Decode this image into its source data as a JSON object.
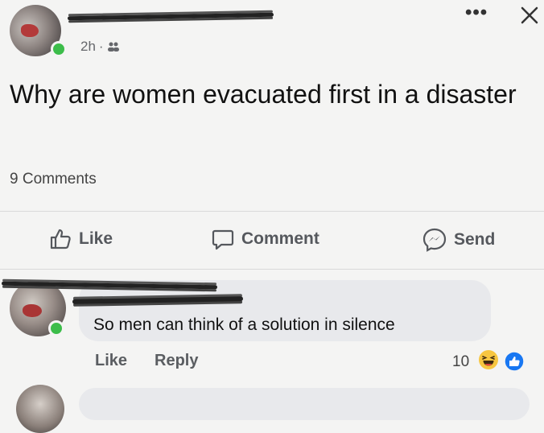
{
  "post": {
    "author_name": "",
    "time": "2h",
    "separator": "·",
    "audience_icon": "people-icon",
    "text": "Why are women evacuated first in a disaster",
    "comments_count": "9 Comments"
  },
  "header_icons": {
    "more": "•••",
    "close": "close-icon"
  },
  "actions": {
    "like": "Like",
    "comment": "Comment",
    "send": "Send"
  },
  "comment": {
    "author_name": "",
    "text": "So men can think of a solution in silence",
    "like_label": "Like",
    "reply_label": "Reply",
    "reaction_count": "10",
    "reactions": [
      "haha-icon",
      "like-icon"
    ]
  },
  "colors": {
    "online": "#3cbd4a",
    "like_blue": "#1877f2",
    "haha_yellow": "#f7c640"
  }
}
